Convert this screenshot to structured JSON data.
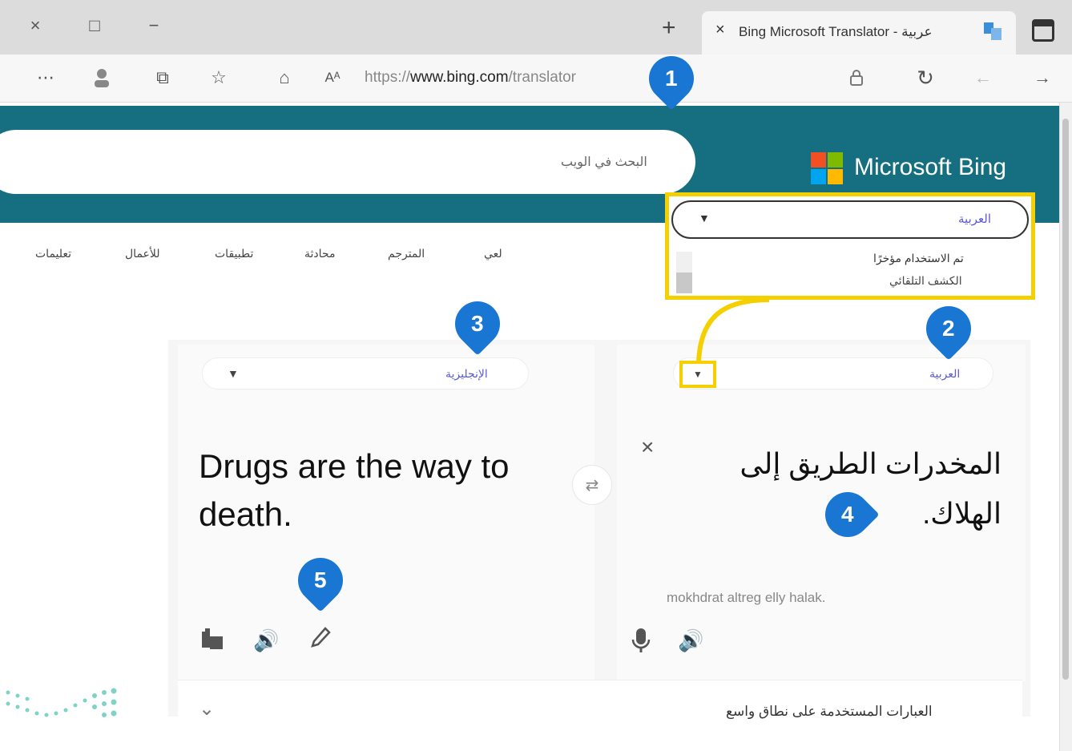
{
  "browser": {
    "tab_title": "Bing Microsoft Translator - عربية",
    "tab_close": "×",
    "new_tab": "+",
    "url_prefix": "https://",
    "url_domain": "www.bing.com",
    "url_path": "/translator",
    "window_close": "×",
    "window_restore": "□",
    "window_minimize": "−"
  },
  "bing": {
    "brand": "Microsoft Bing",
    "search_placeholder": "البحث في الويب",
    "nav": [
      "لعي",
      "المترجم",
      "محادثة",
      "تطبيقات",
      "للأعمال",
      "تعليمات"
    ]
  },
  "language_dropdown": {
    "selected": "العربية",
    "options": [
      "تم الاستخدام مؤخرًا",
      "الكشف التلقائي"
    ]
  },
  "translator": {
    "source_language": "العربية",
    "target_language": "الإنجليزية",
    "source_text": "المخدرات الطريق إلى الهلاك.",
    "transliteration": "mokhdrat altreg elly halak.",
    "target_text": "Drugs are the way to death.",
    "clear": "×",
    "swap": "⇄",
    "phrases_label": "العبارات المستخدمة على نطاق واسع"
  },
  "callouts": [
    "1",
    "2",
    "3",
    "4",
    "5"
  ],
  "colors": {
    "bing_teal": "#156f80",
    "highlight_yellow": "#f5d000",
    "callout_blue": "#1976d2",
    "language_link": "#5a5ad6"
  }
}
